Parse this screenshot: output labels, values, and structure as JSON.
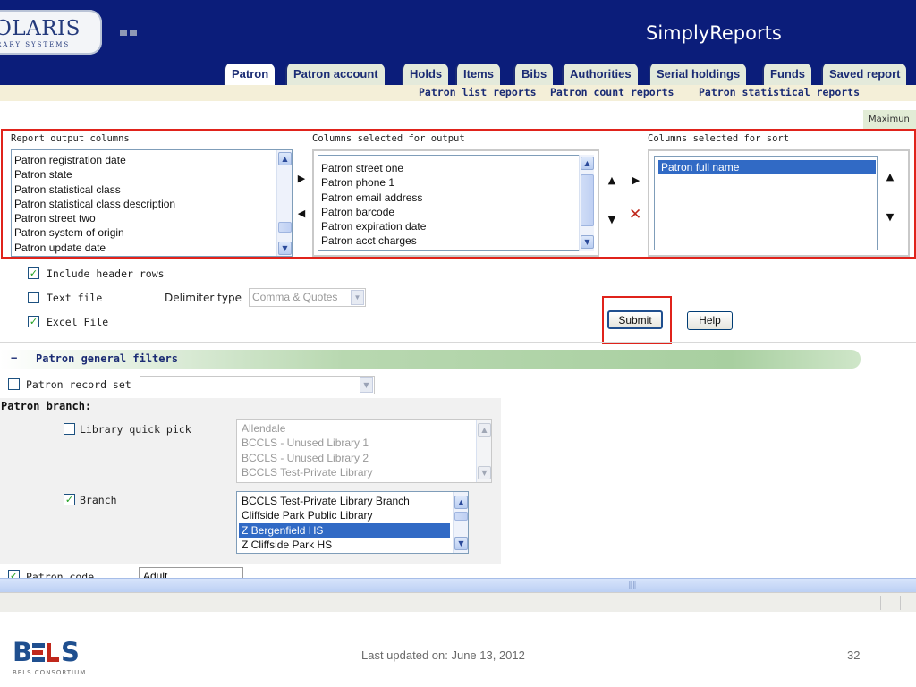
{
  "header": {
    "logo_text": "OLARIS",
    "logo_sub": "RARY SYSTEMS",
    "app_title": "SimplyReports"
  },
  "tabs": [
    {
      "label": "Patron",
      "active": true
    },
    {
      "label": "Patron account",
      "active": false
    },
    {
      "label": "Holds",
      "active": false
    },
    {
      "label": "Items",
      "active": false
    },
    {
      "label": "Bibs",
      "active": false
    },
    {
      "label": "Authorities",
      "active": false
    },
    {
      "label": "Serial holdings",
      "active": false
    },
    {
      "label": "Funds",
      "active": false
    },
    {
      "label": "Saved report",
      "active": false
    }
  ],
  "subnav": [
    "Patron list reports",
    "Patron count reports",
    "Patron statistical reports"
  ],
  "max_label": "Maximun",
  "columns": {
    "output_label": "Report output columns",
    "selected_label": "Columns selected for output",
    "sort_label": "Columns selected for sort",
    "output_items": [
      "Patron registration date",
      "Patron state",
      "Patron statistical class",
      "Patron statistical class description",
      "Patron street two",
      "Patron system of origin",
      "Patron update date"
    ],
    "selected_items": [
      "Patron street one",
      "Patron phone 1",
      "Patron email address",
      "Patron barcode",
      "Patron expiration date",
      "Patron acct charges"
    ],
    "sort_items": [
      "Patron full name"
    ]
  },
  "options": {
    "include_header": {
      "label": "Include header rows",
      "checked": true
    },
    "text_file": {
      "label": "Text file",
      "checked": false
    },
    "excel_file": {
      "label": "Excel File",
      "checked": true
    },
    "delimiter_label": "Delimiter type",
    "delimiter_value": "Comma & Quotes",
    "submit_label": "Submit",
    "help_label": "Help"
  },
  "filters": {
    "dash": "−",
    "title": "Patron general filters",
    "record_set_label": "Patron record set",
    "branch_title": "Patron branch:",
    "quick_pick_label": "Library quick pick",
    "quick_pick_items": [
      "Allendale",
      "BCCLS - Unused Library 1",
      "BCCLS - Unused Library 2",
      "BCCLS Test-Private Library"
    ],
    "branch_label": "Branch",
    "branch_items": [
      "BCCLS Test-Private Library Branch",
      "Cliffside Park Public Library",
      "Z Bergenfield HS",
      "Z Cliffside Park HS"
    ],
    "branch_selected": "Z Bergenfield HS",
    "patron_code_label": "Patron code",
    "patron_code_value": "Adult"
  },
  "footer": {
    "logo_text": "BELS",
    "logo_sub": "BELS CONSORTIUM",
    "note": "Last updated on: June 13, 2012",
    "page": "32"
  },
  "colors": {
    "header_bg": "#0b1d7a",
    "highlight": "#e0231b",
    "selection": "#316ac5",
    "filter_bar": "#b8d8b0"
  }
}
